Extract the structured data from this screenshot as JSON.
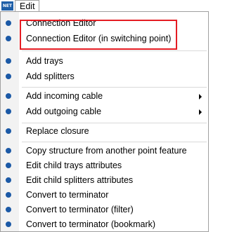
{
  "menubar": {
    "app_icon_text": "NET",
    "menu_title": "Edit"
  },
  "menu": {
    "items": [
      {
        "label": "Connection Editor"
      },
      {
        "label": "Connection Editor (in switching point)"
      },
      {
        "label": "Add trays"
      },
      {
        "label": "Add splitters"
      },
      {
        "label": "Add incoming cable",
        "submenu": true
      },
      {
        "label": "Add outgoing cable",
        "submenu": true
      },
      {
        "label": "Replace closure"
      },
      {
        "label": "Copy structure from another point feature"
      },
      {
        "label": "Edit child trays attributes"
      },
      {
        "label": "Edit child splitters attributes"
      },
      {
        "label": "Convert to terminator"
      },
      {
        "label": "Convert to terminator (filter)"
      },
      {
        "label": "Convert to terminator (bookmark)"
      }
    ]
  },
  "colors": {
    "bullet": "#1b59a6",
    "highlight_border": "#e51c23",
    "app_icon_bg": "#1f5fa8"
  }
}
